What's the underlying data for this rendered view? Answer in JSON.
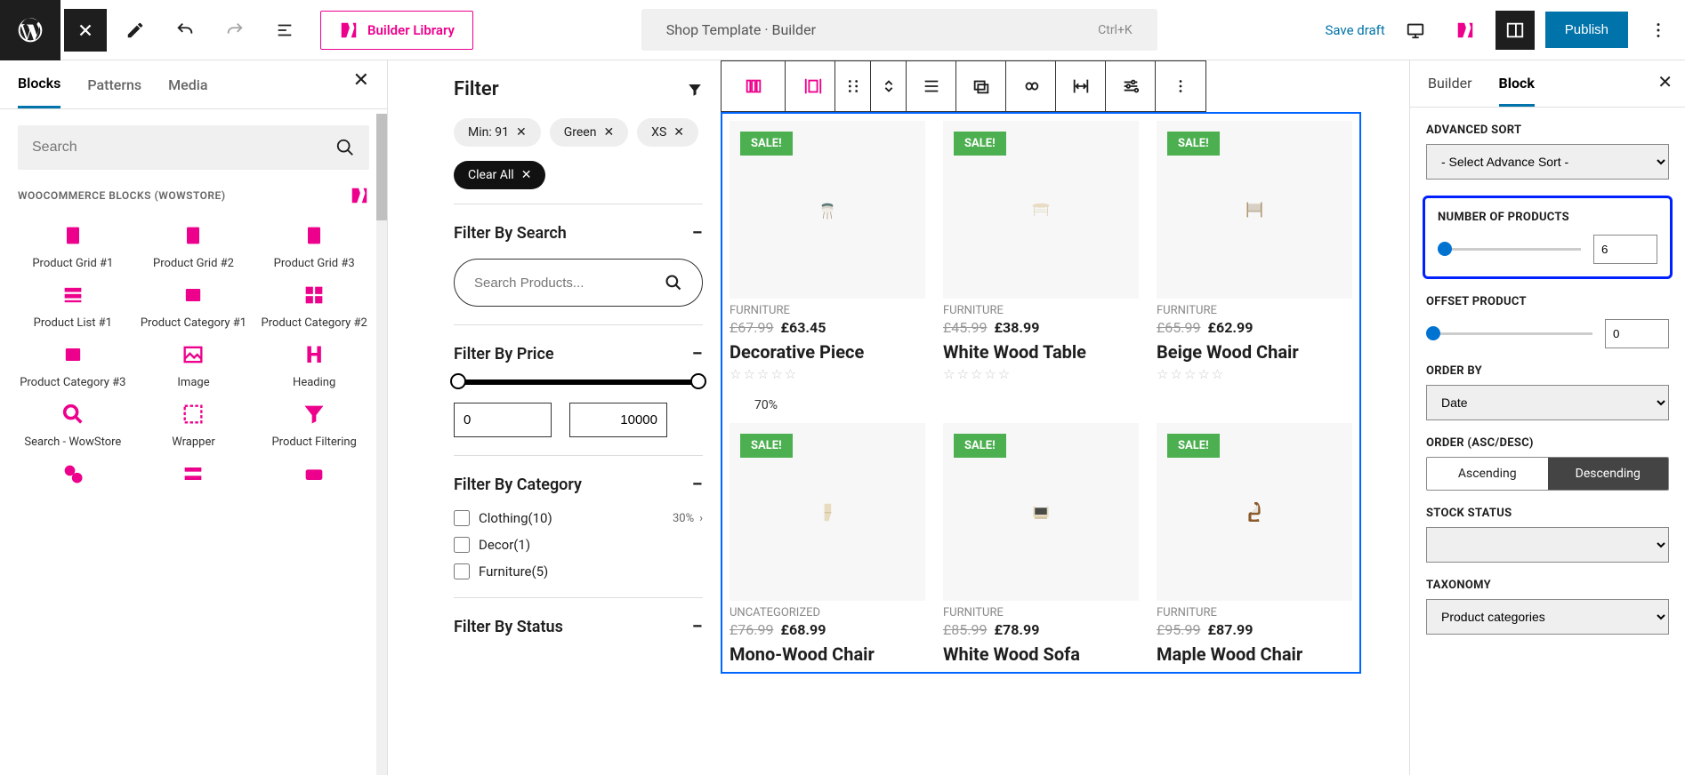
{
  "topbar": {
    "builder_library": "Builder Library",
    "page_title": "Shop Template · Builder",
    "shortcut": "Ctrl+K",
    "save_draft": "Save draft",
    "publish": "Publish"
  },
  "left_panel": {
    "tabs": [
      "Blocks",
      "Patterns",
      "Media"
    ],
    "search_placeholder": "Search",
    "category_title": "WOOCOMMERCE BLOCKS (WOWSTORE)",
    "blocks": [
      "Product Grid #1",
      "Product Grid #2",
      "Product Grid #3",
      "Product List #1",
      "Product Category #1",
      "Product Category #2",
      "Product Category #3",
      "Image",
      "Heading",
      "Search - WowStore",
      "Wrapper",
      "Product Filtering"
    ]
  },
  "filter": {
    "title": "Filter",
    "chips": [
      "Min: 91",
      "Green",
      "XS"
    ],
    "clear_all": "Clear All",
    "sections": {
      "search": {
        "title": "Filter By Search",
        "placeholder": "Search Products..."
      },
      "price": {
        "title": "Filter By Price",
        "min": "0",
        "max": "10000"
      },
      "category": {
        "title": "Filter By Category",
        "items": [
          {
            "label": "Clothing(10)",
            "pct": "30%"
          },
          {
            "label": "Decor(1)"
          },
          {
            "label": "Furniture(5)"
          }
        ]
      },
      "status": {
        "title": "Filter By Status"
      }
    }
  },
  "products": {
    "sale": "SALE!",
    "pct": "70%",
    "row1": [
      {
        "cat": "FURNITURE",
        "old": "£67.99",
        "new": "£63.45",
        "title": "Decorative Piece"
      },
      {
        "cat": "FURNITURE",
        "old": "£45.99",
        "new": "£38.99",
        "title": "White Wood Table"
      },
      {
        "cat": "FURNITURE",
        "old": "£65.99",
        "new": "£62.99",
        "title": "Beige Wood Chair"
      }
    ],
    "row2": [
      {
        "cat": "UNCATEGORIZED",
        "old": "£76.99",
        "new": "£68.99",
        "title": "Mono-Wood Chair"
      },
      {
        "cat": "FURNITURE",
        "old": "£85.99",
        "new": "£78.99",
        "title": "White Wood Sofa"
      },
      {
        "cat": "FURNITURE",
        "old": "£95.99",
        "new": "£87.99",
        "title": "Maple Wood Chair"
      }
    ]
  },
  "right_panel": {
    "tabs": [
      "Builder",
      "Block"
    ],
    "advanced_sort": {
      "label": "ADVANCED SORT",
      "placeholder": "- Select Advance Sort -"
    },
    "num_products": {
      "label": "NUMBER OF PRODUCTS",
      "value": "6"
    },
    "offset": {
      "label": "OFFSET PRODUCT",
      "value": "0"
    },
    "order_by": {
      "label": "ORDER BY",
      "value": "Date"
    },
    "order": {
      "label": "ORDER (ASC/DESC)",
      "asc": "Ascending",
      "desc": "Descending"
    },
    "stock": {
      "label": "STOCK STATUS"
    },
    "taxonomy": {
      "label": "TAXONOMY",
      "value": "Product categories"
    }
  }
}
